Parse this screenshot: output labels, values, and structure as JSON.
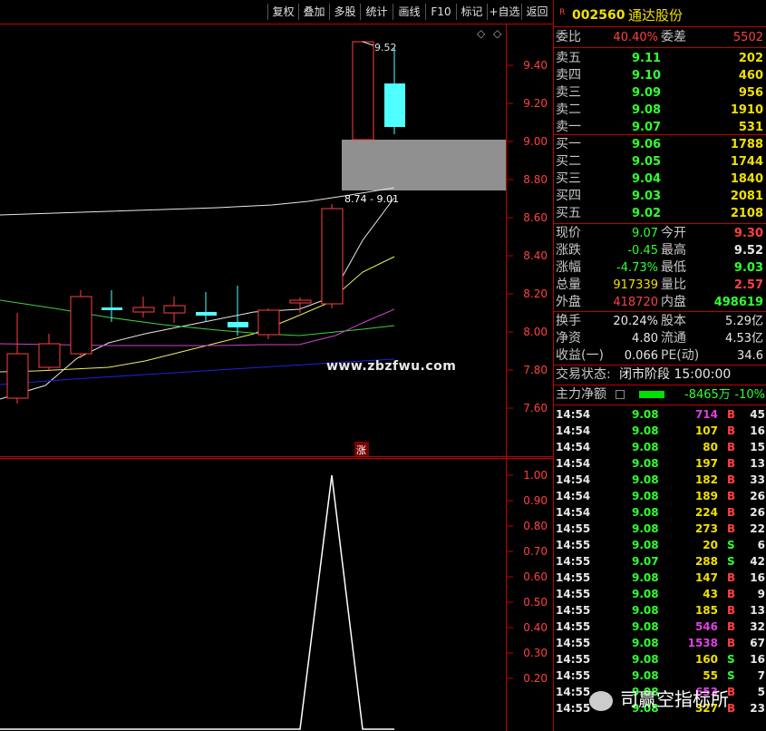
{
  "toolbar": {
    "buttons": [
      "复权",
      "叠加",
      "多股",
      "统计",
      "画线",
      "F10",
      "标记",
      "+自选",
      "返回"
    ]
  },
  "price_axis": [
    "9.40",
    "9.20",
    "9.00",
    "8.80",
    "8.60",
    "8.40",
    "8.20",
    "8.00",
    "7.80",
    "7.60"
  ],
  "chart_labels": {
    "high_label": "9.52",
    "range_label": "8.74 - 9.01",
    "limit_up_marker": "涨"
  },
  "indicator_axis": [
    "1.00",
    "0.90",
    "0.80",
    "0.70",
    "0.60",
    "0.50",
    "0.40",
    "0.30",
    "0.20"
  ],
  "watermark": "www.zbzfwu.com",
  "brand": "司赢空指标所",
  "stock": {
    "flag": "R",
    "code": "002560",
    "name": "通达股份"
  },
  "ratio": {
    "wb_label": "委比",
    "wb_value": "40.40%",
    "wc_label": "委差",
    "wc_value": "5502"
  },
  "asks": [
    {
      "label": "卖五",
      "price": "9.11",
      "vol": "202"
    },
    {
      "label": "卖四",
      "price": "9.10",
      "vol": "460"
    },
    {
      "label": "卖三",
      "price": "9.09",
      "vol": "956"
    },
    {
      "label": "卖二",
      "price": "9.08",
      "vol": "1910"
    },
    {
      "label": "卖一",
      "price": "9.07",
      "vol": "531"
    }
  ],
  "bids": [
    {
      "label": "买一",
      "price": "9.06",
      "vol": "1788"
    },
    {
      "label": "买二",
      "price": "9.05",
      "vol": "1744"
    },
    {
      "label": "买三",
      "price": "9.04",
      "vol": "1840"
    },
    {
      "label": "买四",
      "price": "9.03",
      "vol": "2081"
    },
    {
      "label": "买五",
      "price": "9.02",
      "vol": "2108"
    }
  ],
  "quote": [
    {
      "l1": "现价",
      "v1": "9.07",
      "c1": "green",
      "l2": "今开",
      "v2": "9.30",
      "c2": "red"
    },
    {
      "l1": "涨跌",
      "v1": "-0.45",
      "c1": "green",
      "l2": "最高",
      "v2": "9.52",
      "c2": "white"
    },
    {
      "l1": "涨幅",
      "v1": "-4.73%",
      "c1": "green",
      "l2": "最低",
      "v2": "9.03",
      "c2": "green"
    },
    {
      "l1": "总量",
      "v1": "917339",
      "c1": "yellow",
      "l2": "量比",
      "v2": "2.57",
      "c2": "red"
    },
    {
      "l1": "外盘",
      "v1": "418720",
      "c1": "red",
      "l2": "内盘",
      "v2": "498619",
      "c2": "green"
    }
  ],
  "stats": [
    {
      "l1": "换手",
      "v1": "20.24%",
      "l2": "股本",
      "v2": "5.29亿"
    },
    {
      "l1": "净资",
      "v1": "4.80",
      "l2": "流通",
      "v2": "4.53亿"
    },
    {
      "l1": "收益(一)",
      "v1": "0.066",
      "l2": "PE(动)",
      "v2": "34.6"
    }
  ],
  "trade_status": {
    "label": "交易状态:",
    "value": "闭市阶段 15:00:00"
  },
  "main_flow": {
    "label": "主力净额",
    "value": "-8465万",
    "pct": "-10%"
  },
  "ticks": [
    {
      "t": "14:54",
      "p": "9.08",
      "v": "714",
      "vc": "mag",
      "s": "B",
      "n": "45"
    },
    {
      "t": "14:54",
      "p": "9.08",
      "v": "107",
      "vc": "yellow",
      "s": "B",
      "n": "16"
    },
    {
      "t": "14:54",
      "p": "9.08",
      "v": "80",
      "vc": "yellow",
      "s": "B",
      "n": "15"
    },
    {
      "t": "14:54",
      "p": "9.08",
      "v": "197",
      "vc": "yellow",
      "s": "B",
      "n": "13"
    },
    {
      "t": "14:54",
      "p": "9.08",
      "v": "182",
      "vc": "yellow",
      "s": "B",
      "n": "33"
    },
    {
      "t": "14:54",
      "p": "9.08",
      "v": "189",
      "vc": "yellow",
      "s": "B",
      "n": "26"
    },
    {
      "t": "14:54",
      "p": "9.08",
      "v": "224",
      "vc": "yellow",
      "s": "B",
      "n": "26"
    },
    {
      "t": "14:55",
      "p": "9.08",
      "v": "273",
      "vc": "yellow",
      "s": "B",
      "n": "22"
    },
    {
      "t": "14:55",
      "p": "9.08",
      "v": "20",
      "vc": "yellow",
      "s": "S",
      "n": "6"
    },
    {
      "t": "14:55",
      "p": "9.07",
      "v": "288",
      "vc": "yellow",
      "s": "S",
      "n": "42"
    },
    {
      "t": "14:55",
      "p": "9.08",
      "v": "147",
      "vc": "yellow",
      "s": "B",
      "n": "16"
    },
    {
      "t": "14:55",
      "p": "9.08",
      "v": "43",
      "vc": "yellow",
      "s": "B",
      "n": "9"
    },
    {
      "t": "14:55",
      "p": "9.08",
      "v": "185",
      "vc": "yellow",
      "s": "B",
      "n": "13"
    },
    {
      "t": "14:55",
      "p": "9.08",
      "v": "546",
      "vc": "mag",
      "s": "B",
      "n": "32"
    },
    {
      "t": "14:55",
      "p": "9.08",
      "v": "1538",
      "vc": "mag",
      "s": "B",
      "n": "67"
    },
    {
      "t": "14:55",
      "p": "9.08",
      "v": "160",
      "vc": "yellow",
      "s": "S",
      "n": "16"
    },
    {
      "t": "14:55",
      "p": "9.08",
      "v": "55",
      "vc": "yellow",
      "s": "S",
      "n": "7"
    },
    {
      "t": "14:55",
      "p": "9.08",
      "v": "653",
      "vc": "mag",
      "s": "B",
      "n": "5"
    },
    {
      "t": "14:55",
      "p": "9.08",
      "v": "327",
      "vc": "yellow",
      "s": "B",
      "n": "23"
    }
  ],
  "colors": {
    "up": "#ff4040",
    "down": "#50ffff",
    "border": "#c00000",
    "flow_bar": "#00e000"
  }
}
